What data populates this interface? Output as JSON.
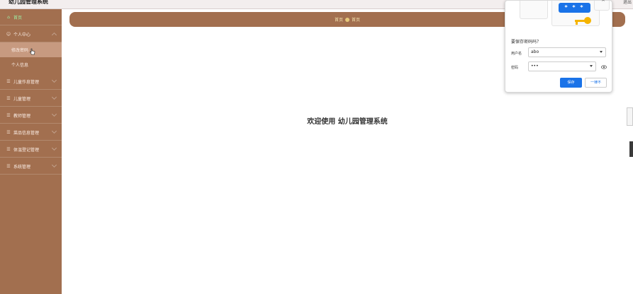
{
  "app": {
    "title": "幼儿园管理系统",
    "topbar_right": "退出"
  },
  "sidebar": {
    "items": [
      {
        "label": "首页",
        "icon": "home-icon"
      },
      {
        "label": "个人中心",
        "icon": "user-icon"
      },
      {
        "label": "儿童作息管理",
        "icon": "list-icon"
      },
      {
        "label": "儿童管理",
        "icon": "list-icon"
      },
      {
        "label": "教师管理",
        "icon": "list-icon"
      },
      {
        "label": "菜品信息管理",
        "icon": "list-icon"
      },
      {
        "label": "体温登记管理",
        "icon": "list-icon"
      },
      {
        "label": "系统管理",
        "icon": "list-icon"
      }
    ],
    "sub_items": [
      {
        "label": "修改密码",
        "active": true
      },
      {
        "label": "个人信息",
        "active": false
      }
    ]
  },
  "breadcrumb": {
    "root": "首页",
    "current": "首页"
  },
  "main": {
    "welcome": "欢迎使用 幼儿园管理系统"
  },
  "password_popup": {
    "art_password": "* * *",
    "title": "要保存密码吗？",
    "username_label": "用户名",
    "username_value": "abo",
    "password_label": "密码",
    "password_value": "•••",
    "save_button": "保存",
    "never_button": "一律不"
  },
  "colors": {
    "sidebar": "#a26f4f",
    "accent_blue": "#1a73e8"
  }
}
